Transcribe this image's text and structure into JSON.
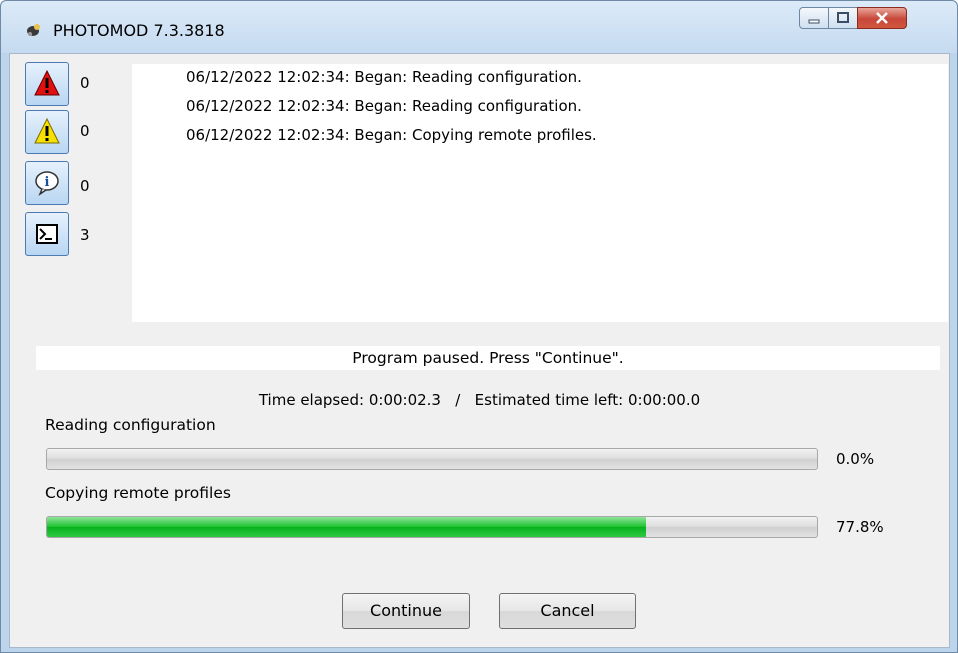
{
  "window": {
    "title": "PHOTOMOD 7.3.3818"
  },
  "severity": [
    {
      "name": "errors",
      "icon": "red-alert-icon",
      "count": "0",
      "color": "#e01010"
    },
    {
      "name": "warnings",
      "icon": "yellow-warning-icon",
      "count": "0",
      "color": "#f5e000"
    },
    {
      "name": "info",
      "icon": "info-icon",
      "count": "0"
    },
    {
      "name": "messages",
      "icon": "console-icon",
      "count": "3"
    }
  ],
  "log": [
    "06/12/2022 12:02:34: Began: Reading configuration.",
    "06/12/2022 12:02:34: Began: Reading configuration.",
    "06/12/2022 12:02:34: Began: Copying remote profiles."
  ],
  "status_text": "Program paused. Press \"Continue\".",
  "timing": {
    "elapsed_label": "Time elapsed:",
    "elapsed_value": "0:00:02.3",
    "separator": "/",
    "left_label": "Estimated time left:",
    "left_value": "0:00:00.0"
  },
  "tasks": [
    {
      "label": "Reading configuration",
      "percent_text": "0.0%",
      "progress": 0.0
    },
    {
      "label": "Copying remote profiles",
      "percent_text": "77.8%",
      "progress": 0.778
    }
  ],
  "buttons": {
    "continue": "Continue",
    "cancel": "Cancel"
  },
  "colors": {
    "progress_green": "#19c22c",
    "accent_blue": "#4d79b4"
  }
}
